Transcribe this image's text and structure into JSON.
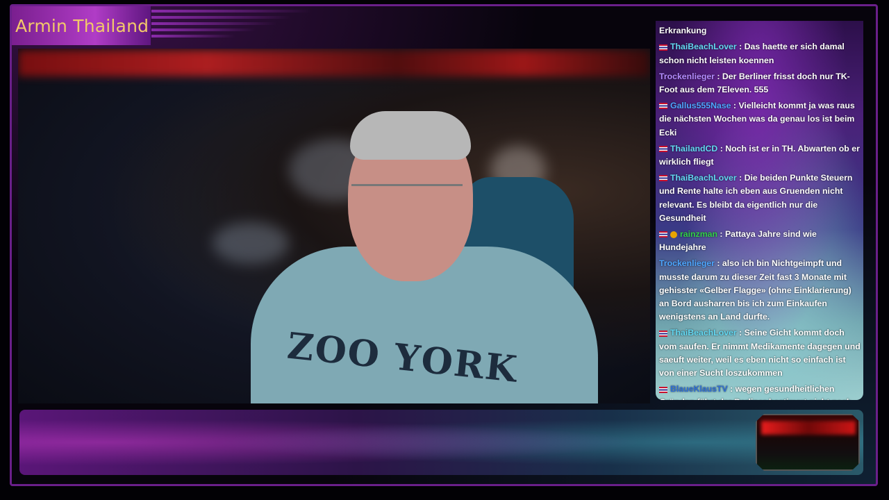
{
  "overlay": {
    "title": "Armin Thailand"
  },
  "video": {
    "shirt_text": "ZOO YORK"
  },
  "chat": {
    "top_partial": "Deutschland helfen bei einer schweren Erkrankung",
    "messages": [
      {
        "user": "ThaiBeachLover",
        "color": "#63d8f2",
        "flag": true,
        "badge": false,
        "text": "Das haette er sich damal schon nicht leisten koennen"
      },
      {
        "user": "Trockenlieger",
        "color": "#b48cff",
        "flag": false,
        "badge": false,
        "text": "Der Berliner frisst doch nur TK-Foot aus dem 7Eleven. 555"
      },
      {
        "user": "Gallus555Nase",
        "color": "#4ea6ff",
        "flag": true,
        "badge": false,
        "text": "Vielleicht kommt ja was raus die nächsten Wochen was da genau los ist beim Ecki"
      },
      {
        "user": "ThailandCD",
        "color": "#63d8f2",
        "flag": true,
        "badge": false,
        "text": "Noch ist er in TH. Abwarten ob er wirklich fliegt"
      },
      {
        "user": "ThaiBeachLover",
        "color": "#63d8f2",
        "flag": true,
        "badge": false,
        "text": "Die beiden Punkte Steuern und Rente halte ich eben aus Gruenden nicht relevant. Es bleibt da eigentlich nur die Gesundheit"
      },
      {
        "user": "rainzman",
        "color": "#32d14a",
        "flag": true,
        "badge": true,
        "text": "Pattaya Jahre sind wie Hundejahre"
      },
      {
        "user": "Trockenlieger",
        "color": "#4ea6ff",
        "flag": false,
        "badge": false,
        "text": "also ich bin Nichtgeimpft und musste darum zu dieser Zeit fast 3 Monate mit gehisster «Gelber Flagge» (ohne Einklarierung) an Bord ausharren bis ich zum Einkaufen wenigstens an Land durfte."
      },
      {
        "user": "ThaiBeachLover",
        "color": "#63d8f2",
        "flag": true,
        "badge": false,
        "text": "Seine Gicht kommt doch vom saufen. Er nimmt Medikamente dagegen und saeuft weiter, weil es eben nicht so einfach ist von einer Sucht loszukommen"
      },
      {
        "user": "BlaueKlausTV",
        "color": "#2f6fd6",
        "flag": true,
        "badge": false,
        "text": "wegen gesundheitlichen Gründen fährt der Berliner bestimmt nicht nach Deutschland,bevor er da versorgt wird ist er schon gestorben"
      }
    ]
  }
}
